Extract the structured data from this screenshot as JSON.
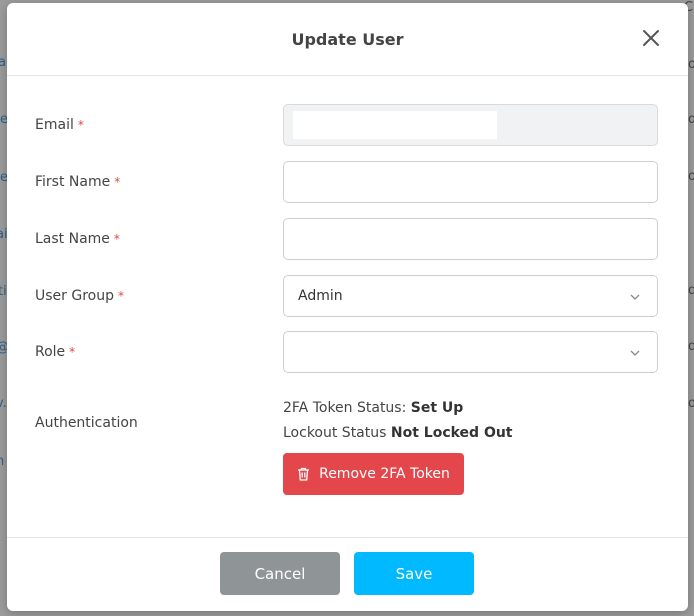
{
  "background": {
    "left_fragments": [
      "ar",
      "e",
      "e",
      "ai",
      "ti",
      "@",
      "v.",
      "n"
    ],
    "right_fragments": [
      "C",
      "o",
      "o",
      "o",
      "o",
      "o",
      "o"
    ]
  },
  "modal": {
    "title": "Update User",
    "close_icon": "close-icon"
  },
  "form": {
    "email": {
      "label": "Email",
      "required": "*",
      "value": ""
    },
    "first_name": {
      "label": "First Name",
      "required": "*",
      "value": ""
    },
    "last_name": {
      "label": "Last Name",
      "required": "*",
      "value": ""
    },
    "user_group": {
      "label": "User Group",
      "required": "*",
      "value": "Admin"
    },
    "role": {
      "label": "Role",
      "required": "*",
      "value": ""
    },
    "authentication": {
      "label": "Authentication",
      "token_status_label": "2FA Token Status:",
      "token_status_value": "Set Up",
      "lockout_label": "Lockout Status",
      "lockout_value": "Not Locked Out",
      "remove_button": "Remove 2FA Token"
    }
  },
  "footer": {
    "cancel_label": "Cancel",
    "save_label": "Save"
  },
  "colors": {
    "required": "#e0463f",
    "danger": "#e3474b",
    "primary": "#00b9ff",
    "secondary": "#8f9496"
  }
}
